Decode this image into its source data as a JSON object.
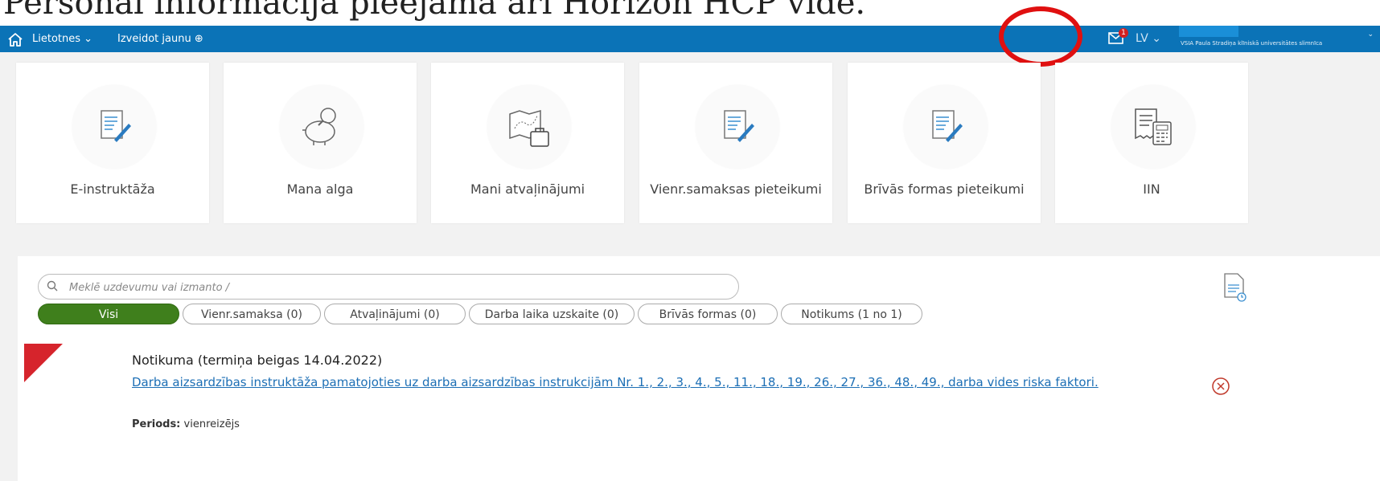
{
  "doc_heading": "Personal informācija pieejama arī Horizon HCP vidē.",
  "topbar": {
    "apps_label": "Lietotnes ⌄",
    "create_label": "Izveidot jaunu ⊕",
    "mail_badge": "1",
    "lang_label": "LV ⌄",
    "org_name": "VSIA Paula Stradiņa klīniskā universitātes slimnīca",
    "org_chevron": "⌄"
  },
  "tiles": [
    {
      "label": "E-instruktāža",
      "icon": "document-edit-icon"
    },
    {
      "label": "Mana alga",
      "icon": "piggy-bank-icon"
    },
    {
      "label": "Mani atvaļinājumi",
      "icon": "travel-map-icon"
    },
    {
      "label": "Vienr.samaksas pieteikumi",
      "icon": "document-edit-icon"
    },
    {
      "label": "Brīvās formas pieteikumi",
      "icon": "document-edit-icon"
    },
    {
      "label": "IIN",
      "icon": "receipt-calculator-icon"
    }
  ],
  "search": {
    "placeholder": "Meklē uzdevumu vai izmanto /"
  },
  "filters": [
    {
      "label": "Visi",
      "active": true
    },
    {
      "label": "Vienr.samaksa (0)",
      "active": false
    },
    {
      "label": "Atvaļinājumi (0)",
      "active": false
    },
    {
      "label": "Darba laika uzskaite (0)",
      "active": false
    },
    {
      "label": "Brīvās formas (0)",
      "active": false
    },
    {
      "label": "Notikums (1 no 1)",
      "active": false
    }
  ],
  "task": {
    "title": "Notikuma (termiņa beigas 14.04.2022)",
    "link": "Darba aizsardzības instruktāža pamatojoties uz darba aizsardzības instrukcijām Nr. 1., 2., 3., 4., 5., 11., 18., 19., 26., 27., 36., 48., 49., darba vides riska faktori.",
    "period_label": "Periods:",
    "period_value": "vienreizējs"
  },
  "colors": {
    "topbar": "#0b73b7",
    "active_filter": "#3f7f1c",
    "link": "#1d6fb5",
    "flag": "#d6242c",
    "highlight_circle": "#e01010"
  }
}
